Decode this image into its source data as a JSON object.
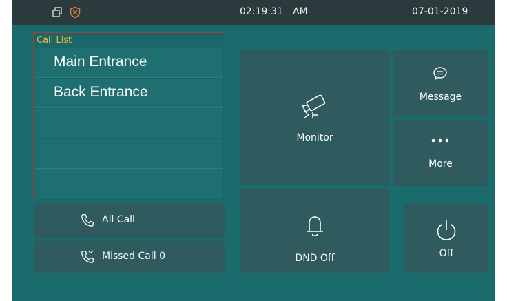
{
  "statusbar": {
    "time": "02:19:31",
    "ampm": "AM",
    "date": "07-01-2019",
    "icons": [
      "windows-icon",
      "shield-icon"
    ]
  },
  "call_list": {
    "title": "Call List",
    "items": [
      {
        "label": "Main Entrance"
      },
      {
        "label": "Back Entrance"
      },
      {
        "label": ""
      },
      {
        "label": ""
      },
      {
        "label": ""
      }
    ]
  },
  "call_buttons": {
    "all_call": "All Call",
    "missed_call": "Missed Call 0"
  },
  "tiles": {
    "monitor": "Monitor",
    "message": "Message",
    "more": "More",
    "dnd": "DND Off",
    "power": "Off"
  },
  "colors": {
    "background": "#1b6a6c",
    "statusbar": "#2b3a3d",
    "tile": "#2f5a5e",
    "call_list_border": "#a63c37",
    "call_list_title": "#f0b43a"
  }
}
